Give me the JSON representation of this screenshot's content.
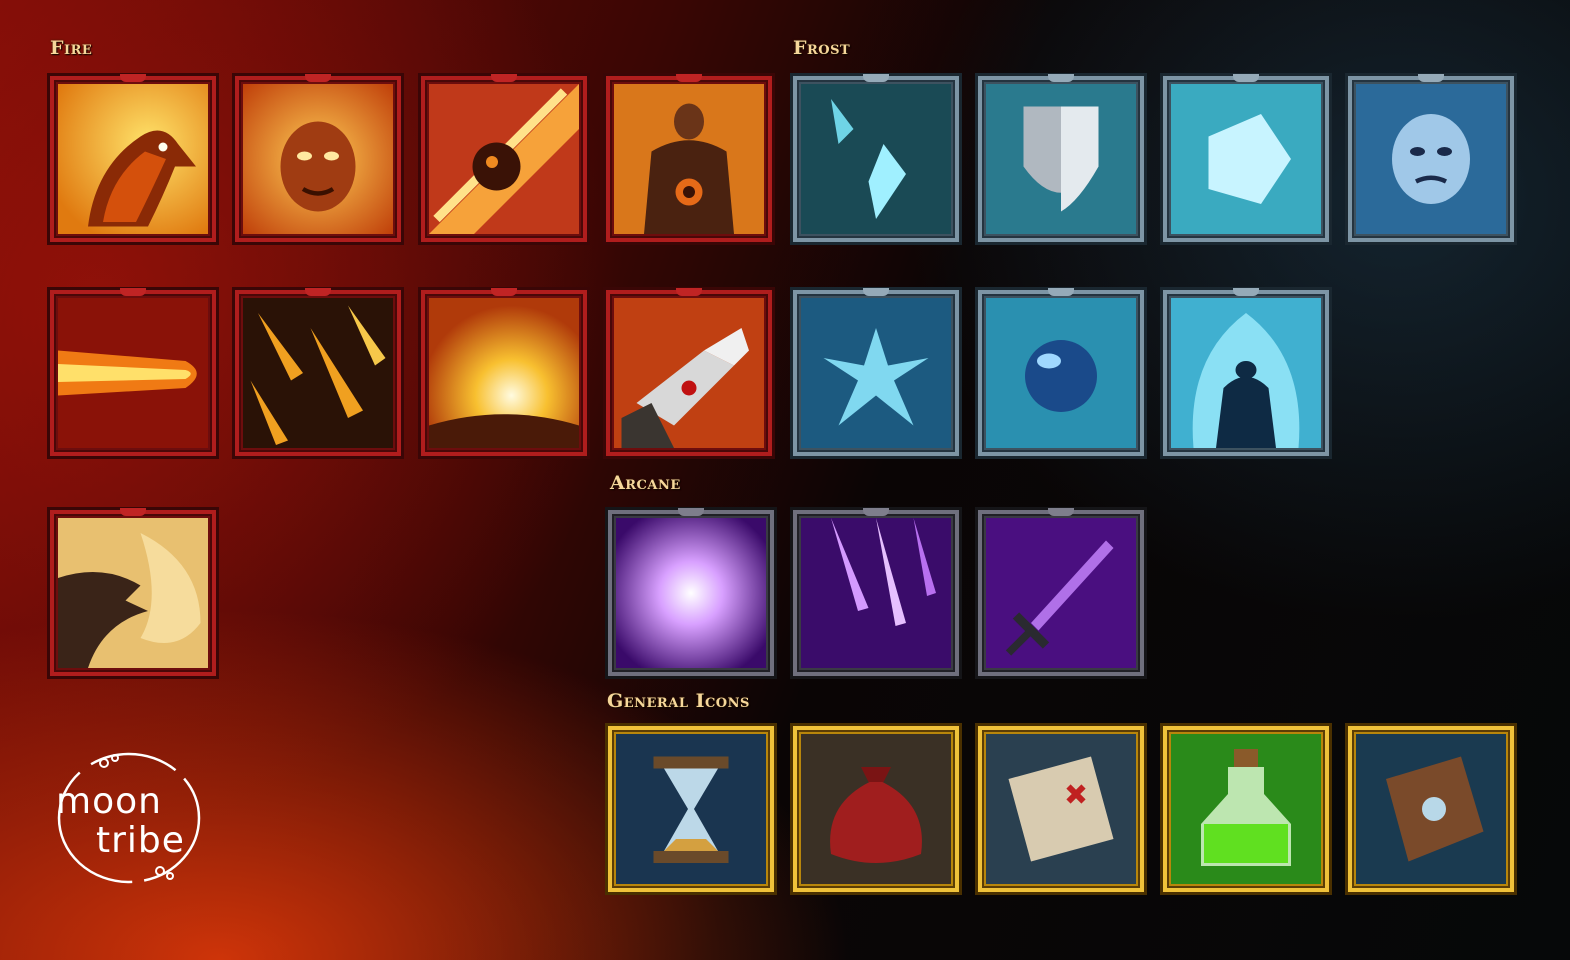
{
  "sections": {
    "fire": {
      "title": "Fire"
    },
    "frost": {
      "title": "Frost"
    },
    "arcane": {
      "title": "Arcane"
    },
    "general": {
      "title": "General Icons"
    }
  },
  "icons": {
    "fire": [
      "phoenix-icon",
      "fire-face-icon",
      "meteor-icon",
      "fire-warrior-icon",
      "fireball-icon",
      "fire-rain-icon",
      "explosion-icon",
      "fire-gauntlet-icon",
      "fire-dragon-icon"
    ],
    "frost": [
      "ice-shard-icon",
      "ice-shield-icon",
      "ice-block-icon",
      "frost-face-icon",
      "frost-nova-icon",
      "frost-orb-icon",
      "frost-golem-icon"
    ],
    "arcane": [
      "arcane-burst-icon",
      "arcane-missiles-icon",
      "arcane-sword-icon"
    ],
    "general": [
      "hourglass-icon",
      "bag-icon",
      "map-scroll-icon",
      "potion-icon",
      "spellbook-icon"
    ]
  },
  "colors": {
    "title": "#f6d79a",
    "fire_frame": "#b01d1d",
    "frost_frame": "#7d95a5",
    "arcane_frame": "#6f6f7d",
    "general_frame": "#f0c23a"
  },
  "logo": {
    "line1": "moon",
    "line2": "tribe"
  }
}
